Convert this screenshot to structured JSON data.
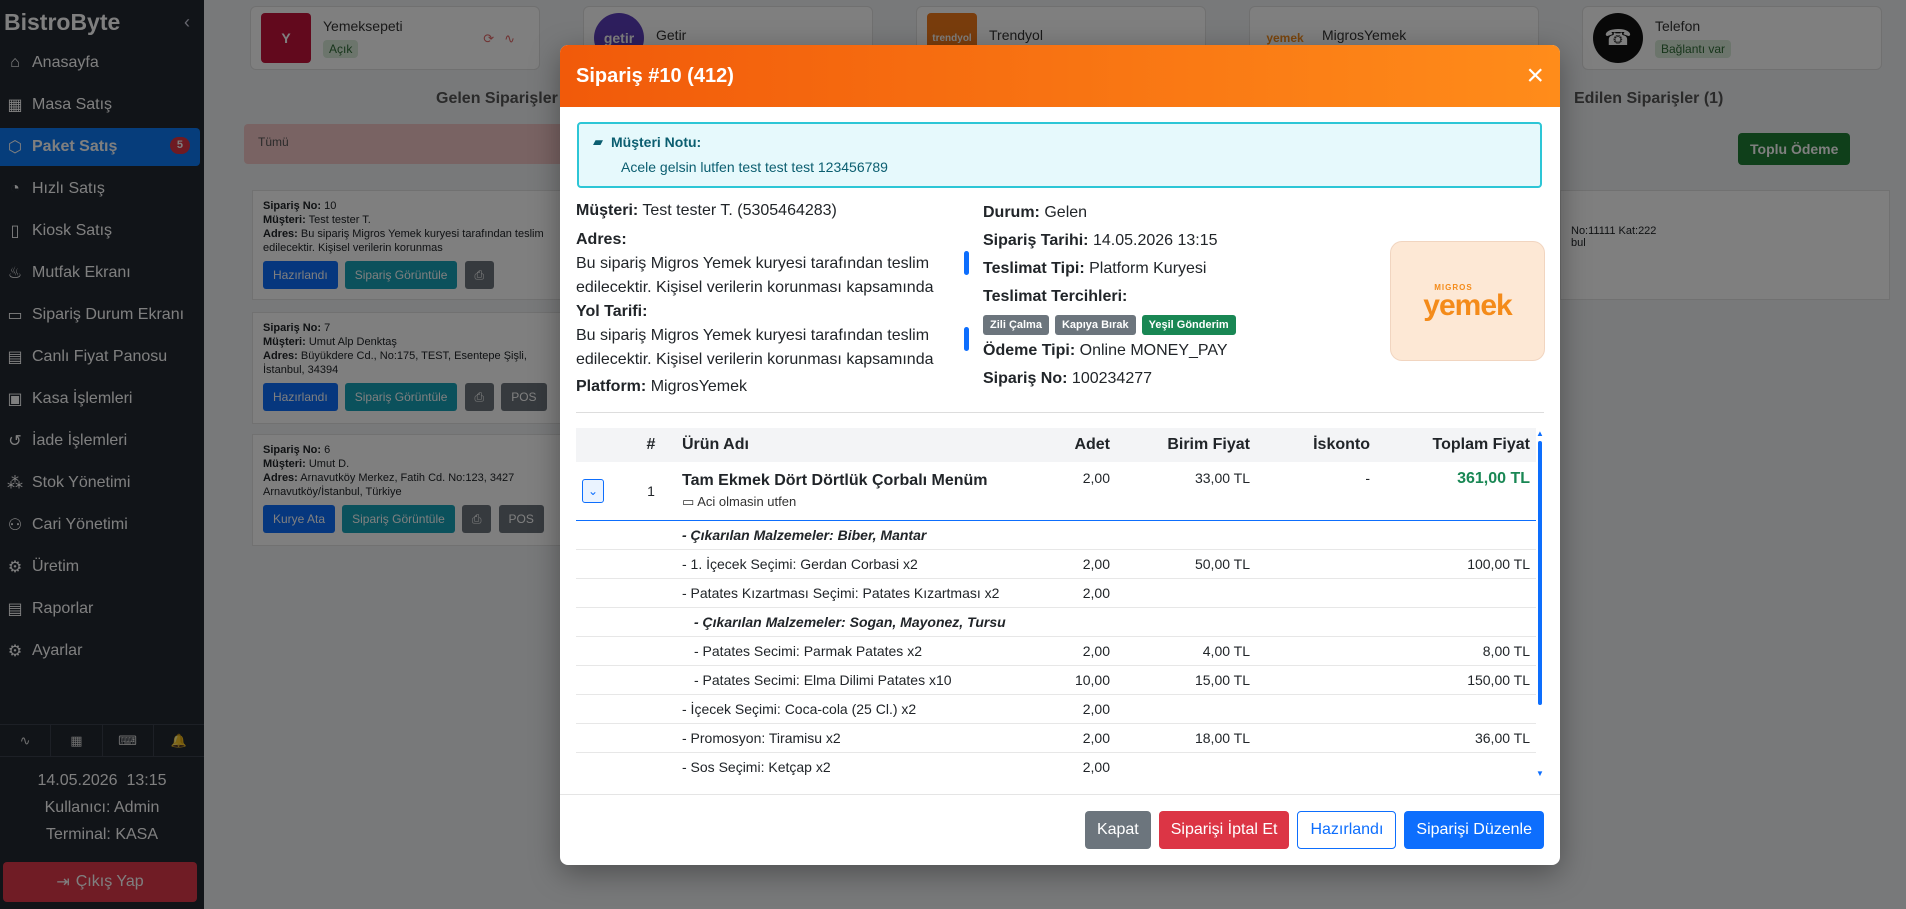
{
  "app": {
    "brand": "BistroByte"
  },
  "sidebar": {
    "items": [
      {
        "label": "Anasayfa",
        "icon": "home-icon"
      },
      {
        "label": "Masa Satış",
        "icon": "grid-icon"
      },
      {
        "label": "Paket Satış",
        "icon": "box-icon",
        "badge": "5",
        "active": true
      },
      {
        "label": "Hızlı Satış",
        "icon": "gauge-icon"
      },
      {
        "label": "Kiosk Satış",
        "icon": "tablet-icon"
      },
      {
        "label": "Mutfak Ekranı",
        "icon": "fire-icon"
      },
      {
        "label": "Sipariş Durum Ekranı",
        "icon": "monitor-icon"
      },
      {
        "label": "Canlı Fiyat Panosu",
        "icon": "dashboard-icon"
      },
      {
        "label": "Kasa İşlemleri",
        "icon": "cash-register-icon"
      },
      {
        "label": "İade İşlemleri",
        "icon": "refund-icon"
      },
      {
        "label": "Stok Yönetimi",
        "icon": "boxes-icon"
      },
      {
        "label": "Cari Yönetimi",
        "icon": "users-icon"
      },
      {
        "label": "Üretim",
        "icon": "gear-icon"
      },
      {
        "label": "Raporlar",
        "icon": "report-icon"
      },
      {
        "label": "Ayarlar",
        "icon": "settings-icon"
      }
    ],
    "date": "14.05.2026",
    "time": "13:15",
    "user": "Kullanıcı: Admin",
    "terminal": "Terminal: KASA",
    "logout_label": "Çıkış Yap"
  },
  "platforms": [
    {
      "name": "Yemeksepeti",
      "status": "Açık",
      "logo_text": "Y",
      "color": "#c4133b"
    },
    {
      "name": "Getir",
      "status": "",
      "logo_text": "getir",
      "color": "#5d3ebc"
    },
    {
      "name": "Trendyol",
      "status": "",
      "logo_text": "trendyol",
      "color": "#f27a1a"
    },
    {
      "name": "MigrosYemek",
      "status": "",
      "logo_text": "yemek",
      "color": "#f48b1a"
    },
    {
      "name": "Telefon",
      "status": "Bağlantı var",
      "logo_text": "☎",
      "color": "#111111"
    }
  ],
  "background": {
    "incoming_title": "Gelen Siparişler (",
    "delivered_title": "Edilen Siparişler (1)",
    "select_all": "Tümü",
    "bulk_pay": "Toplu Ödeme",
    "cards": [
      {
        "no": "10",
        "customer": "Test tester T.",
        "address": "Bu sipariş Migros Yemek kuryesi tarafından teslim edilecektir. Kişisel verilerin korunmas",
        "btn1": "Hazırlandı",
        "btn2": "Sipariş Görüntüle"
      },
      {
        "no": "7",
        "customer": "Umut Alp Denktaş",
        "address": "Büyükdere Cd., No:175, TEST, Esentepe Şişli, İstanbul, 34394",
        "btn1": "Hazırlandı",
        "btn2": "Sipariş Görüntüle"
      },
      {
        "no": "6",
        "customer": "Umut D.",
        "address": "Arnavutköy Merkez, Fatih Cd. No:123, 3427 Arnavutköy/İstanbul, Türkiye",
        "btn1": "Kurye Ata",
        "btn2": "Sipariş Görüntüle"
      }
    ],
    "right_card_text": "No:11111 Kat:222",
    "right_card_text2": "bul",
    "labels": {
      "no": "Sipariş No:",
      "customer": "Müşteri:",
      "address": "Adres:",
      "pos": "POS"
    }
  },
  "modal": {
    "title": "Sipariş #10 (412)",
    "note_title": "Müşteri Notu:",
    "note_text": "Acele gelsin lutfen test test test 123456789",
    "customer_label": "Müşteri:",
    "customer_value": "Test tester T. (5305464283)",
    "address_label": "Adres:",
    "address_value": "Bu sipariş Migros Yemek kuryesi tarafından teslim edilecektir. Kişisel verilerin korunması kapsamında detaylı",
    "route_label": "Yol Tarifi:",
    "route_value": "Bu sipariş Migros Yemek kuryesi tarafından teslim edilecektir. Kişisel verilerin korunması kapsamında detaylı",
    "platform_label": "Platform:",
    "platform_value": "MigrosYemek",
    "status_label": "Durum:",
    "status_value": "Gelen",
    "date_label": "Sipariş Tarihi:",
    "date_value": "14.05.2026 13:15",
    "delivery_label": "Teslimat Tipi:",
    "delivery_value": "Platform Kuryesi",
    "prefs_label": "Teslimat Tercihleri:",
    "prefs": [
      {
        "label": "Zili Çalma",
        "color": "#6c757d"
      },
      {
        "label": "Kapıya Bırak",
        "color": "#6c757d"
      },
      {
        "label": "Yeşil Gönderim",
        "color": "#198754"
      }
    ],
    "payment_label": "Ödeme Tipi:",
    "payment_value": "Online MONEY_PAY",
    "orderno_label": "Sipariş No:",
    "orderno_value": "100234277",
    "logo_small": "MIGROS",
    "logo_big": "yemek",
    "table": {
      "headers": [
        "#",
        "Ürün Adı",
        "Adet",
        "Birim Fiyat",
        "İskonto",
        "Toplam Fiyat"
      ],
      "main": {
        "index": "1",
        "name": "Tam Ekmek Dört Dörtlük Çorbalı Menüm",
        "note": "Aci olmasin utfen",
        "qty": "2,00",
        "unit": "33,00 TL",
        "discount": "-",
        "total": "361,00 TL"
      },
      "rows": [
        {
          "name": "- Çıkarılan Malzemeler: Biber, Mantar",
          "qty": "",
          "unit": "",
          "total": "",
          "style": "it",
          "indent": false
        },
        {
          "name": "- 1. İçecek Seçimi: Gerdan Corbasi x2",
          "qty": "2,00",
          "unit": "50,00 TL",
          "total": "100,00 TL",
          "style": "",
          "indent": false
        },
        {
          "name": "- Patates Kızartması Seçimi: Patates Kızartması x2",
          "qty": "2,00",
          "unit": "",
          "total": "",
          "style": "",
          "indent": false
        },
        {
          "name": "- Çıkarılan Malzemeler: Sogan, Mayonez, Tursu",
          "qty": "",
          "unit": "",
          "total": "",
          "style": "it",
          "indent": true
        },
        {
          "name": "- Patates Secimi: Parmak Patates x2",
          "qty": "2,00",
          "unit": "4,00 TL",
          "total": "8,00 TL",
          "style": "",
          "indent": true
        },
        {
          "name": "- Patates Secimi: Elma Dilimi Patates x10",
          "qty": "10,00",
          "unit": "15,00 TL",
          "total": "150,00 TL",
          "style": "",
          "indent": true
        },
        {
          "name": "- İçecek Seçimi: Coca-cola (25 Cl.) x2",
          "qty": "2,00",
          "unit": "",
          "total": "",
          "style": "",
          "indent": false
        },
        {
          "name": "- Promosyon: Tiramisu x2",
          "qty": "2,00",
          "unit": "18,00 TL",
          "total": "36,00 TL",
          "style": "",
          "indent": false
        },
        {
          "name": "- Sos Seçimi: Ketçap x2",
          "qty": "2,00",
          "unit": "",
          "total": "",
          "style": "",
          "indent": false
        }
      ]
    },
    "buttons": {
      "close": "Kapat",
      "cancel": "Siparişi İptal Et",
      "ready": "Hazırlandı",
      "edit": "Siparişi Düzenle"
    }
  }
}
